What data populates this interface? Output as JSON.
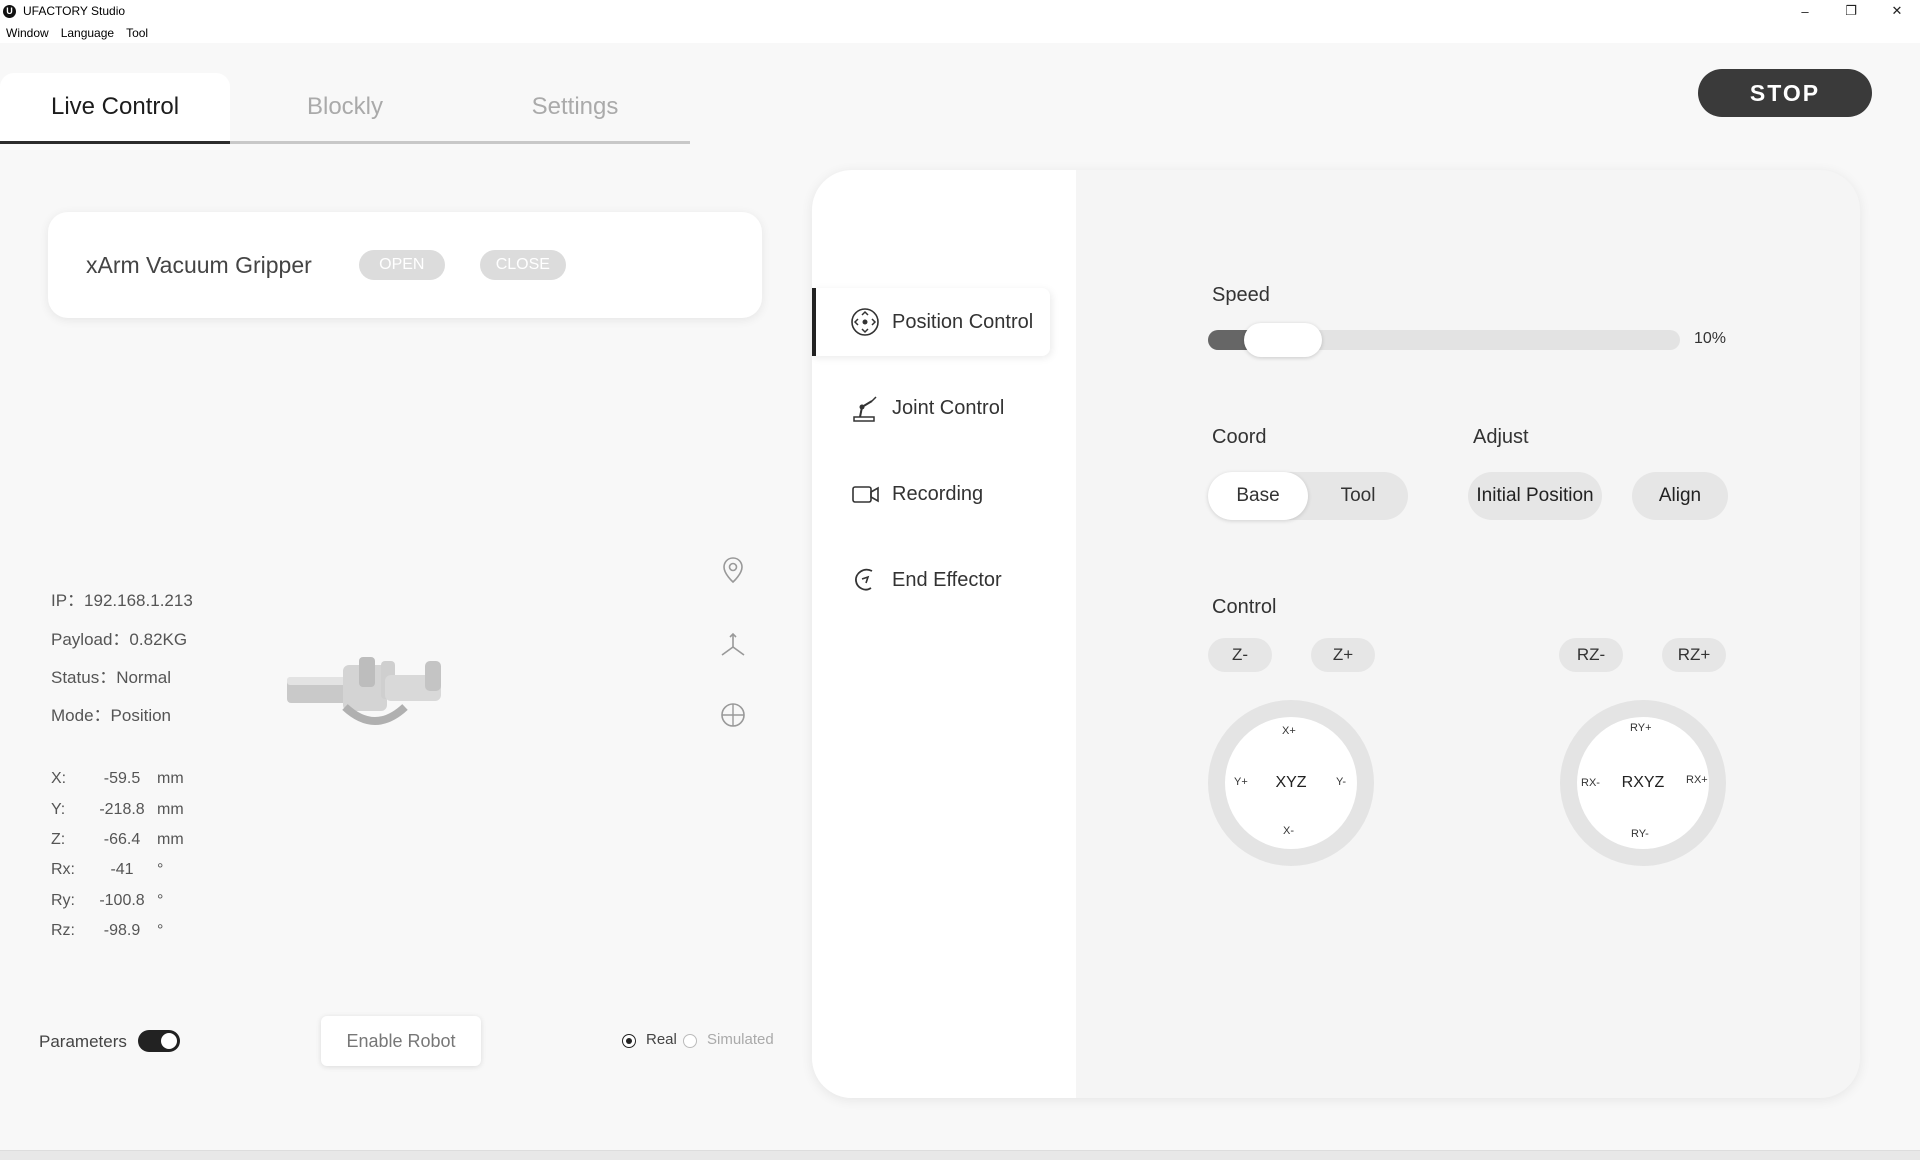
{
  "window": {
    "title": "UFACTORY Studio",
    "icon": "ufactory-logo-icon",
    "minimize": "–",
    "restore": "❐",
    "close": "✕"
  },
  "menu": [
    "Window",
    "Language",
    "Tool"
  ],
  "tabs": [
    {
      "label": "Live Control",
      "active": true
    },
    {
      "label": "Blockly",
      "active": false
    },
    {
      "label": "Settings",
      "active": false
    }
  ],
  "stop_label": "STOP",
  "gripper": {
    "name": "xArm Vacuum Gripper",
    "open_label": "OPEN",
    "close_label": "CLOSE"
  },
  "status": {
    "ip": "IP：192.168.1.213",
    "payload": "Payload：0.82KG",
    "status": "Status：Normal",
    "mode": "Mode：Position"
  },
  "coords": [
    {
      "label": "X:",
      "value": "-59.5",
      "unit": "mm"
    },
    {
      "label": "Y:",
      "value": "-218.8",
      "unit": "mm"
    },
    {
      "label": "Z:",
      "value": "-66.4",
      "unit": "mm"
    },
    {
      "label": "Rx:",
      "value": "-41",
      "unit": "°"
    },
    {
      "label": "Ry:",
      "value": "-100.8",
      "unit": "°"
    },
    {
      "label": "Rz:",
      "value": "-98.9",
      "unit": "°"
    }
  ],
  "bottom": {
    "parameters_label": "Parameters",
    "parameters_on": true,
    "enable_label": "Enable Robot",
    "real_label": "Real",
    "simulated_label": "Simulated",
    "mode_selected": "Real"
  },
  "nav": [
    {
      "label": "Position Control",
      "icon": "position-control-icon",
      "active": true
    },
    {
      "label": "Joint Control",
      "icon": "joint-control-icon",
      "active": false
    },
    {
      "label": "Recording",
      "icon": "video-camera-icon",
      "active": false
    },
    {
      "label": "End Effector",
      "icon": "end-effector-icon",
      "active": false
    }
  ],
  "control": {
    "speed_label": "Speed",
    "speed_value": "10%",
    "speed_fraction": 0.1,
    "coord_label": "Coord",
    "coord_options": [
      "Base",
      "Tool"
    ],
    "coord_selected": "Base",
    "adjust_label": "Adjust",
    "initial_position_label": "Initial Position",
    "align_label": "Align",
    "control_label": "Control",
    "z_minus": "Z-",
    "z_plus": "Z+",
    "rz_minus": "RZ-",
    "rz_plus": "RZ+",
    "xyz": {
      "center": "XYZ",
      "top": "X+",
      "bottom": "X-",
      "left": "Y+",
      "right": "Y-"
    },
    "rxyz": {
      "center": "RXYZ",
      "top": "RY+",
      "bottom": "RY-",
      "left": "RX-",
      "right": "RX+"
    }
  },
  "colors": {
    "accent": "#2b2b2b",
    "stop": "#3a3a3a"
  }
}
